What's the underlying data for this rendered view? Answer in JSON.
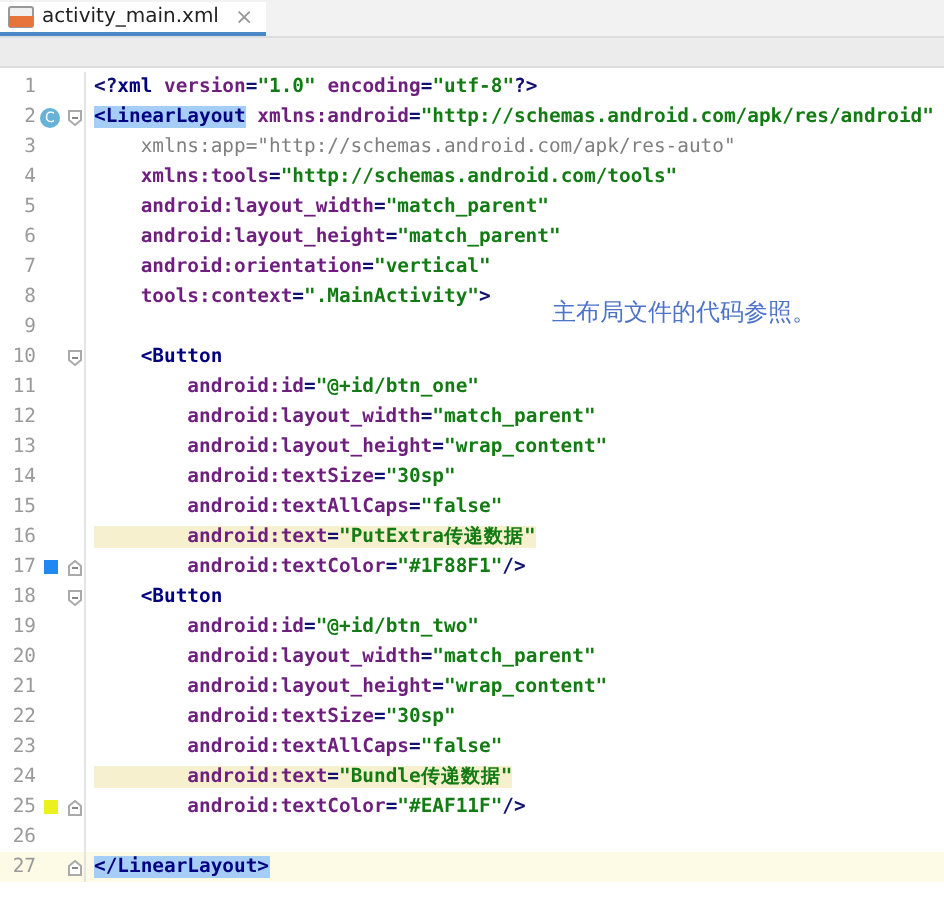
{
  "tab": {
    "title": "activity_main.xml",
    "close": "×",
    "selected": true
  },
  "lines": [
    {
      "number": "1",
      "current": false,
      "highlighted": false,
      "tokens": [
        {
          "kind": "punct",
          "text": "<?"
        },
        {
          "kind": "tag",
          "text": "xml"
        },
        {
          "kind": "attr",
          "text": " version"
        },
        {
          "kind": "punct",
          "text": "="
        },
        {
          "kind": "value",
          "text": "\"1.0\""
        },
        {
          "kind": "attr",
          "text": " encoding"
        },
        {
          "kind": "punct",
          "text": "="
        },
        {
          "kind": "value",
          "text": "\"utf-8\""
        },
        {
          "kind": "punct",
          "text": "?>"
        }
      ]
    },
    {
      "number": "2",
      "current": false,
      "highlighted": false,
      "gutter": {
        "kind": "badge",
        "text": "C"
      },
      "fold": {
        "kind": "start"
      },
      "tokens": [
        {
          "kind": "tag",
          "text": "<LinearLayout",
          "match": true
        },
        {
          "kind": "attr",
          "text": " xmlns:android"
        },
        {
          "kind": "punct",
          "text": "="
        },
        {
          "kind": "value",
          "text": "\"http://schemas.android.com/apk/res/android\""
        }
      ]
    },
    {
      "number": "3",
      "current": false,
      "highlighted": false,
      "tokens": [
        {
          "kind": "unused",
          "text": "    xmlns:app=\"http://schemas.android.com/apk/res-auto\""
        }
      ]
    },
    {
      "number": "4",
      "current": false,
      "highlighted": false,
      "tokens": [
        {
          "kind": "attr",
          "text": "    xmlns:tools"
        },
        {
          "kind": "punct",
          "text": "="
        },
        {
          "kind": "value",
          "text": "\"http://schemas.android.com/tools\""
        }
      ]
    },
    {
      "number": "5",
      "current": false,
      "highlighted": false,
      "tokens": [
        {
          "kind": "attr",
          "text": "    android:layout_width"
        },
        {
          "kind": "punct",
          "text": "="
        },
        {
          "kind": "value",
          "text": "\"match_parent\""
        }
      ]
    },
    {
      "number": "6",
      "current": false,
      "highlighted": false,
      "tokens": [
        {
          "kind": "attr",
          "text": "    android:layout_height"
        },
        {
          "kind": "punct",
          "text": "="
        },
        {
          "kind": "value",
          "text": "\"match_parent\""
        }
      ]
    },
    {
      "number": "7",
      "current": false,
      "highlighted": false,
      "tokens": [
        {
          "kind": "attr",
          "text": "    android:orientation"
        },
        {
          "kind": "punct",
          "text": "="
        },
        {
          "kind": "value",
          "text": "\"vertical\""
        }
      ]
    },
    {
      "number": "8",
      "current": false,
      "highlighted": false,
      "tokens": [
        {
          "kind": "attr",
          "text": "    tools:context"
        },
        {
          "kind": "punct",
          "text": "="
        },
        {
          "kind": "value",
          "text": "\".MainActivity\""
        },
        {
          "kind": "punct",
          "text": ">"
        }
      ]
    },
    {
      "number": "9",
      "current": false
    },
    {
      "number": "10",
      "current": false,
      "highlighted": false,
      "fold": {
        "kind": "start"
      },
      "tokens": [
        {
          "kind": "tag",
          "text": "    <Button"
        }
      ]
    },
    {
      "number": "11",
      "current": false,
      "highlighted": false,
      "tokens": [
        {
          "kind": "attr",
          "text": "        android:id"
        },
        {
          "kind": "punct",
          "text": "="
        },
        {
          "kind": "value",
          "text": "\"@+id/btn_one\""
        }
      ]
    },
    {
      "number": "12",
      "current": false,
      "highlighted": false,
      "tokens": [
        {
          "kind": "attr",
          "text": "        android:layout_width"
        },
        {
          "kind": "punct",
          "text": "="
        },
        {
          "kind": "value",
          "text": "\"match_parent\""
        }
      ]
    },
    {
      "number": "13",
      "current": false,
      "highlighted": false,
      "tokens": [
        {
          "kind": "attr",
          "text": "        android:layout_height"
        },
        {
          "kind": "punct",
          "text": "="
        },
        {
          "kind": "value",
          "text": "\"wrap_content\""
        }
      ]
    },
    {
      "number": "14",
      "current": false,
      "highlighted": false,
      "tokens": [
        {
          "kind": "attr",
          "text": "        android:textSize"
        },
        {
          "kind": "punct",
          "text": "="
        },
        {
          "kind": "value",
          "text": "\"30sp\""
        }
      ]
    },
    {
      "number": "15",
      "current": false,
      "highlighted": false,
      "tokens": [
        {
          "kind": "attr",
          "text": "        android:textAllCaps"
        },
        {
          "kind": "punct",
          "text": "="
        },
        {
          "kind": "value",
          "text": "\"false\""
        }
      ]
    },
    {
      "number": "16",
      "current": false,
      "highlighted": true,
      "tokens": [
        {
          "kind": "attr",
          "text": "        android:text"
        },
        {
          "kind": "punct",
          "text": "="
        },
        {
          "kind": "value",
          "text": "\"PutExtra传递数据\""
        }
      ]
    },
    {
      "number": "17",
      "current": false,
      "highlighted": false,
      "gutter": {
        "kind": "swatch",
        "color": "#1f88f1"
      },
      "fold": {
        "kind": "end"
      },
      "tokens": [
        {
          "kind": "attr",
          "text": "        android:textColor"
        },
        {
          "kind": "punct",
          "text": "="
        },
        {
          "kind": "value",
          "text": "\"#1F88F1\""
        },
        {
          "kind": "punct",
          "text": "/>"
        }
      ]
    },
    {
      "number": "18",
      "current": false,
      "highlighted": false,
      "fold": {
        "kind": "start"
      },
      "tokens": [
        {
          "kind": "tag",
          "text": "    <Button"
        }
      ]
    },
    {
      "number": "19",
      "current": false,
      "highlighted": false,
      "tokens": [
        {
          "kind": "attr",
          "text": "        android:id"
        },
        {
          "kind": "punct",
          "text": "="
        },
        {
          "kind": "value",
          "text": "\"@+id/btn_two\""
        }
      ]
    },
    {
      "number": "20",
      "current": false,
      "highlighted": false,
      "tokens": [
        {
          "kind": "attr",
          "text": "        android:layout_width"
        },
        {
          "kind": "punct",
          "text": "="
        },
        {
          "kind": "value",
          "text": "\"match_parent\""
        }
      ]
    },
    {
      "number": "21",
      "current": false,
      "highlighted": false,
      "tokens": [
        {
          "kind": "attr",
          "text": "        android:layout_height"
        },
        {
          "kind": "punct",
          "text": "="
        },
        {
          "kind": "value",
          "text": "\"wrap_content\""
        }
      ]
    },
    {
      "number": "22",
      "current": false,
      "highlighted": false,
      "tokens": [
        {
          "kind": "attr",
          "text": "        android:textSize"
        },
        {
          "kind": "punct",
          "text": "="
        },
        {
          "kind": "value",
          "text": "\"30sp\""
        }
      ]
    },
    {
      "number": "23",
      "current": false,
      "highlighted": false,
      "tokens": [
        {
          "kind": "attr",
          "text": "        android:textAllCaps"
        },
        {
          "kind": "punct",
          "text": "="
        },
        {
          "kind": "value",
          "text": "\"false\""
        }
      ]
    },
    {
      "number": "24",
      "current": false,
      "highlighted": true,
      "tokens": [
        {
          "kind": "attr",
          "text": "        android:text"
        },
        {
          "kind": "punct",
          "text": "="
        },
        {
          "kind": "value",
          "text": "\"Bundle传递数据\""
        }
      ]
    },
    {
      "number": "25",
      "current": false,
      "highlighted": false,
      "gutter": {
        "kind": "swatch",
        "color": "#eaf11f"
      },
      "fold": {
        "kind": "end"
      },
      "tokens": [
        {
          "kind": "attr",
          "text": "        android:textColor"
        },
        {
          "kind": "punct",
          "text": "="
        },
        {
          "kind": "value",
          "text": "\"#EAF11F\""
        },
        {
          "kind": "punct",
          "text": "/>"
        }
      ]
    },
    {
      "number": "26",
      "current": false
    },
    {
      "number": "27",
      "current": true,
      "highlighted": false,
      "fold": {
        "kind": "end"
      },
      "tokens": [
        {
          "kind": "tag",
          "text": "</LinearLayout>",
          "match": true
        }
      ]
    }
  ],
  "annotation": "主布局文件的代码参照。"
}
